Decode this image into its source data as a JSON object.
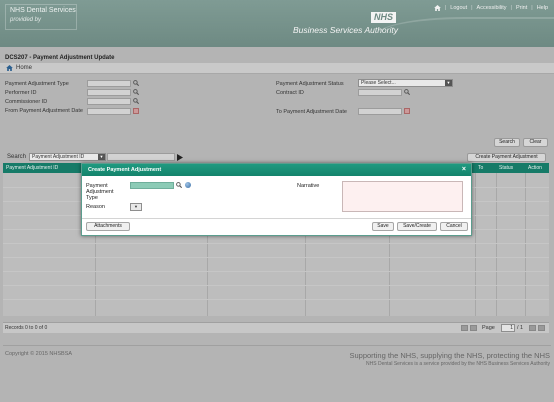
{
  "header": {
    "brand_line1": "NHS Dental Services",
    "brand_line2": "provided by",
    "nhs_logo": "NHS",
    "org_name": "Business Services Authority",
    "links": [
      "Logout",
      "Accessibility",
      "Print",
      "Help"
    ]
  },
  "page": {
    "title": "DCS207 - Payment Adjustment Update",
    "breadcrumb_home": "Home"
  },
  "filters": {
    "payment_adjustment_type_label": "Payment Adjustment Type",
    "performer_id_label": "Performer ID",
    "commissioner_id_label": "Commissioner ID",
    "from_date_label": "From Payment Adjustment Date",
    "status_label": "Payment Adjustment Status",
    "status_value": "Please Select...",
    "contract_id_label": "Contract ID",
    "to_date_label": "To Payment Adjustment Date"
  },
  "actions": {
    "search": "Search",
    "clear": "Clear"
  },
  "search_bar": {
    "label": "Search",
    "field_value": "Payment Adjustment ID",
    "create_button": "Create Payment Adjustment"
  },
  "grid": {
    "columns": [
      "Payment Adjustment ID",
      "To",
      "Status",
      "Action"
    ],
    "records_text": "Records 0 to 0 of 0",
    "page_label": "Page",
    "page_value": "1",
    "page_total": "/ 1"
  },
  "footer": {
    "copyright": "Copyright © 2015 NHSBSA",
    "tagline": "Supporting the NHS, supplying the NHS, protecting the NHS",
    "provided_by": "NHS Dental Services is a service provided by the NHS Business Services Authority"
  },
  "modal": {
    "title": "Create Payment Adjustment",
    "close": "×",
    "type_label": "Payment Adjustment Type",
    "narrative_label": "Narrative",
    "reason_label": "Reason",
    "attachments": "Attachments",
    "save": "Save",
    "save_create": "Save/Create",
    "cancel": "Cancel"
  },
  "colors": {
    "banner": "#6e8a83",
    "grid_header": "#167b68",
    "modal_title": "#14836c"
  }
}
